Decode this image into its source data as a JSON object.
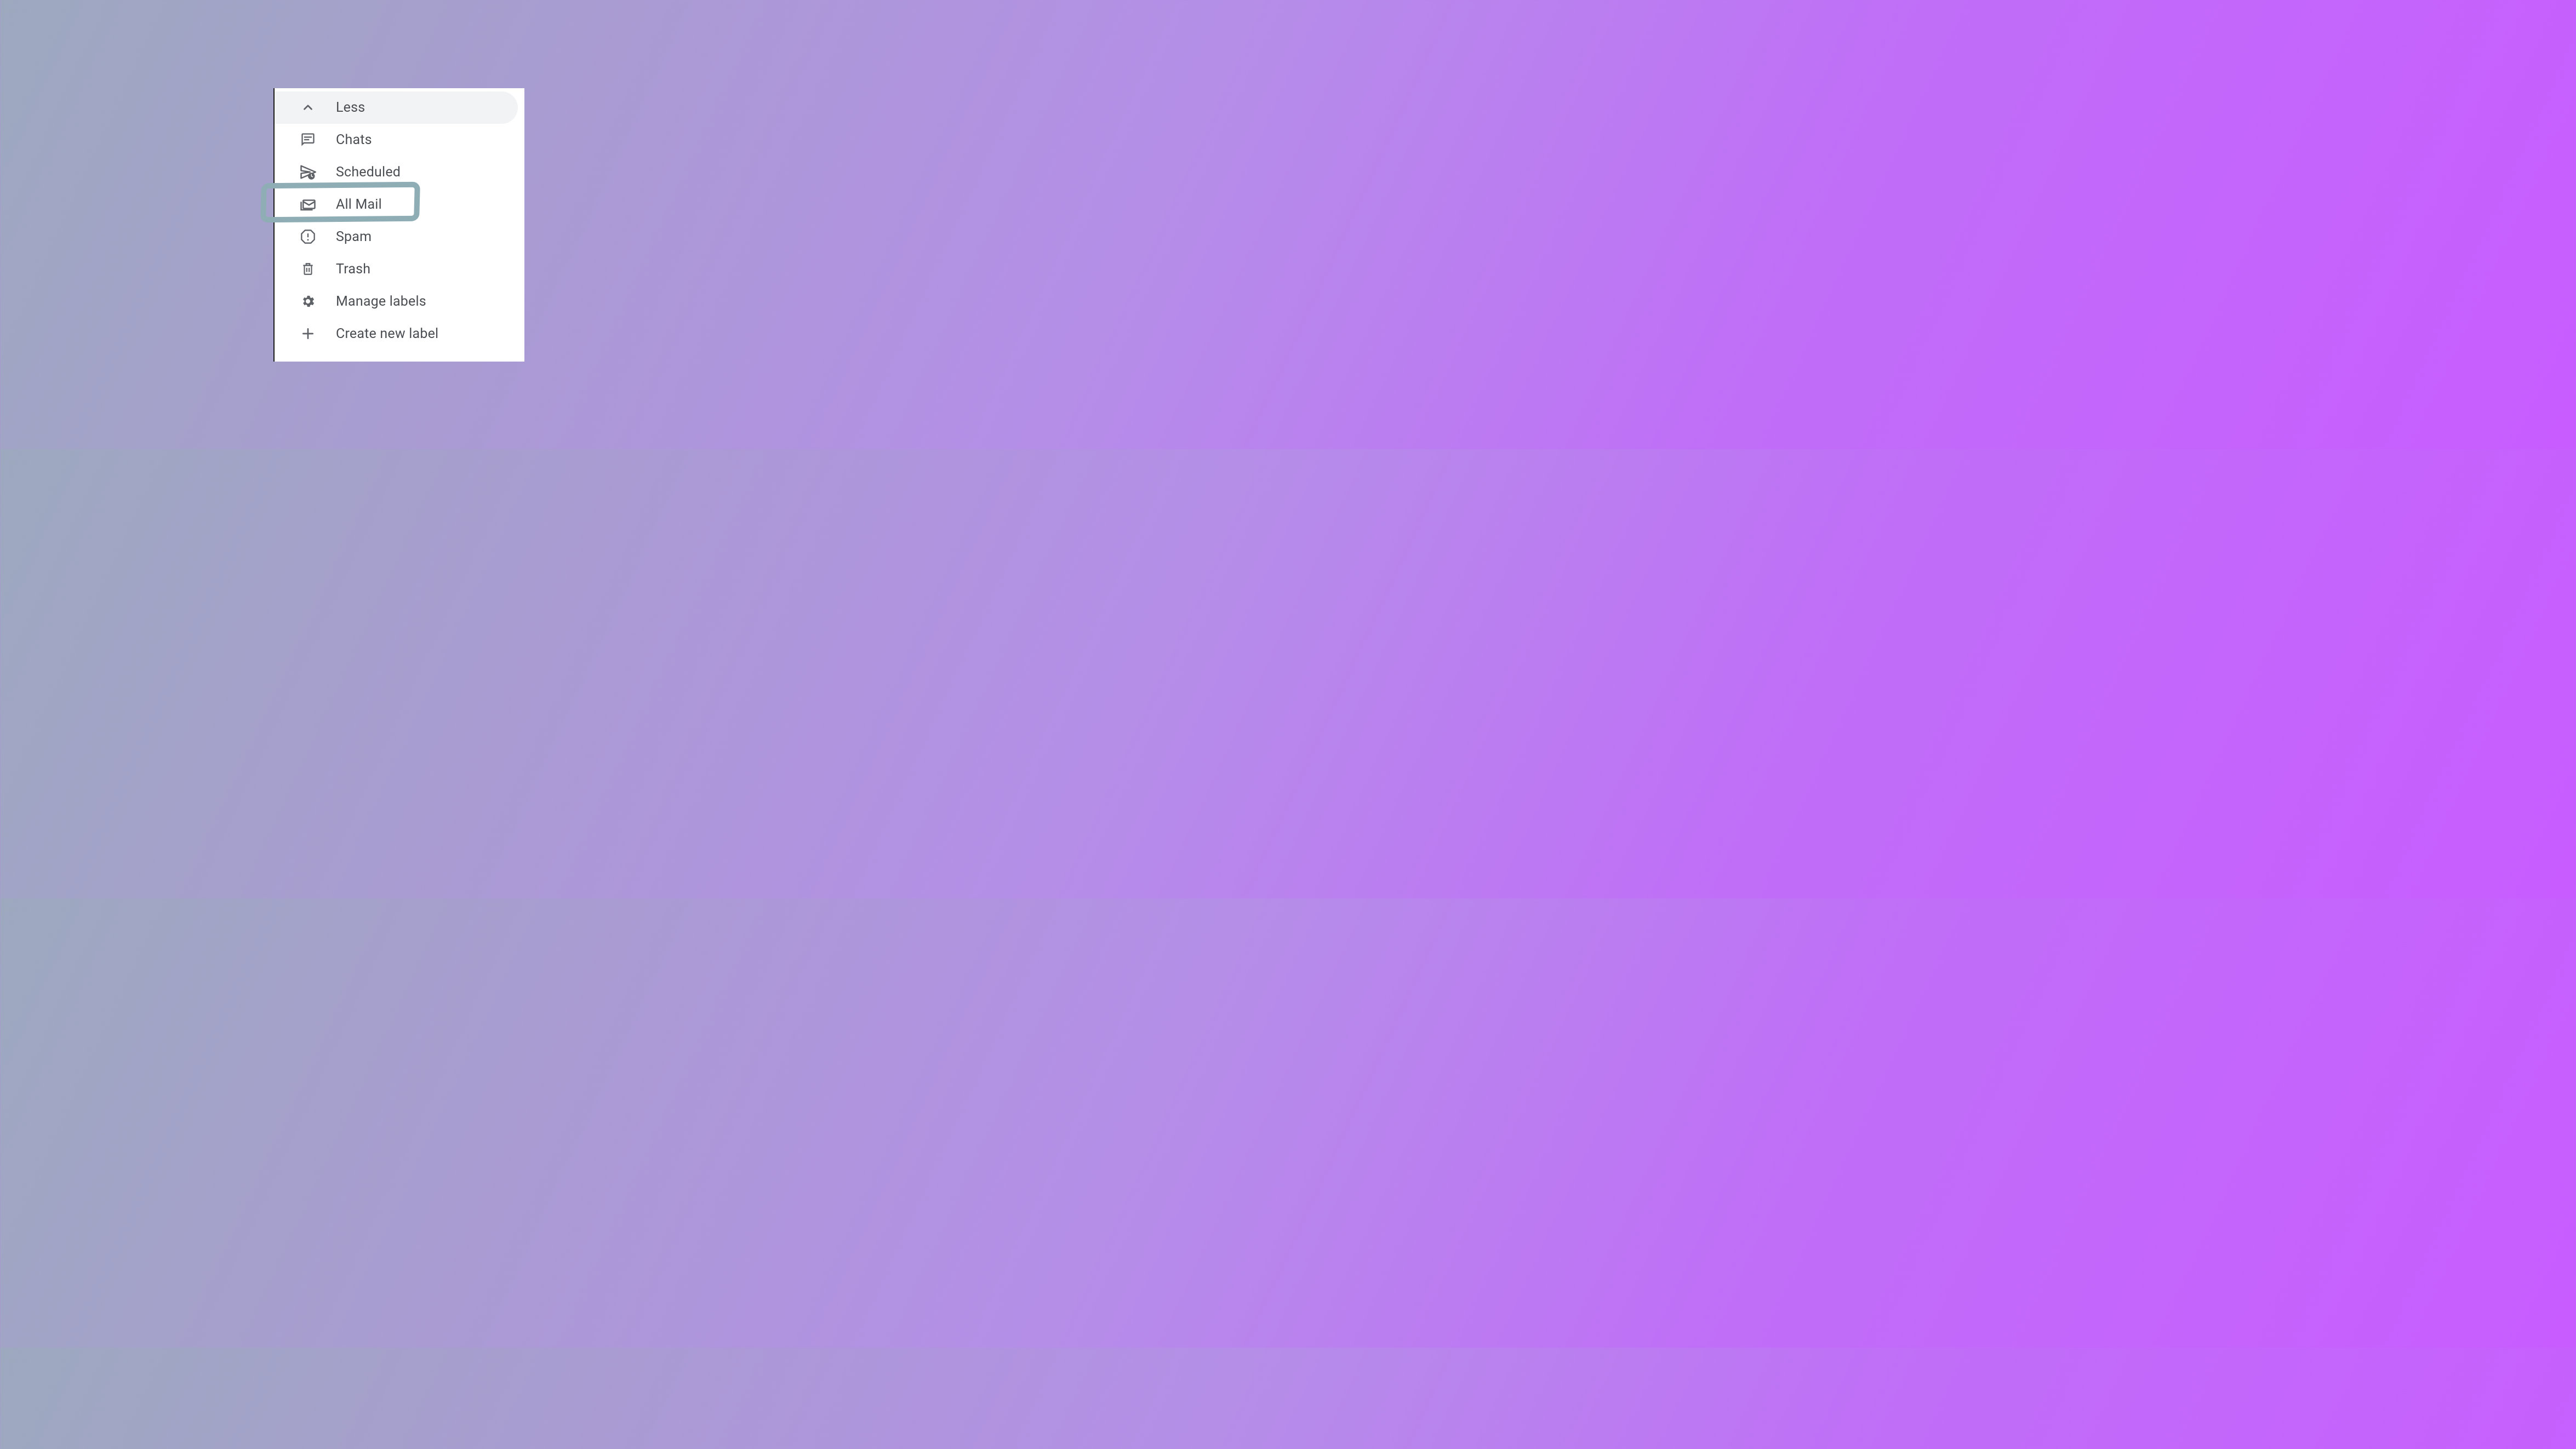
{
  "sidebar": {
    "items": [
      {
        "label": "Less",
        "icon": "chevron-up",
        "hovered": true
      },
      {
        "label": "Chats",
        "icon": "chat"
      },
      {
        "label": "Scheduled",
        "icon": "scheduled-send"
      },
      {
        "label": "All Mail",
        "icon": "stacked-mail",
        "highlighted": true
      },
      {
        "label": "Spam",
        "icon": "spam"
      },
      {
        "label": "Trash",
        "icon": "trash"
      },
      {
        "label": "Manage labels",
        "icon": "gear"
      },
      {
        "label": "Create new label",
        "icon": "plus"
      }
    ]
  },
  "annotation": {
    "highlight_color": "#8eadb5"
  }
}
